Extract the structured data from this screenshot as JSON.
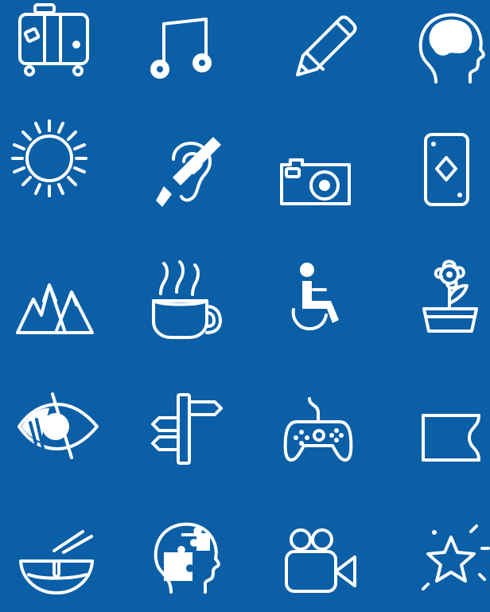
{
  "theme": {
    "background": "#0a5fa6",
    "foreground": "#ffffff"
  },
  "icons": [
    "suitcase-icon",
    "music-note-icon",
    "pencil-icon",
    "brain-head-icon",
    "sun-icon",
    "hearing-loop-icon",
    "camera-icon",
    "playing-card-icon",
    "mountains-icon",
    "hot-cup-icon",
    "wheelchair-icon",
    "potted-flower-icon",
    "blind-eye-icon",
    "signpost-icon",
    "game-controller-icon",
    "ticket-icon",
    "noodle-bowl-icon",
    "puzzle-head-icon",
    "video-camera-icon",
    "sparkle-star-icon"
  ]
}
